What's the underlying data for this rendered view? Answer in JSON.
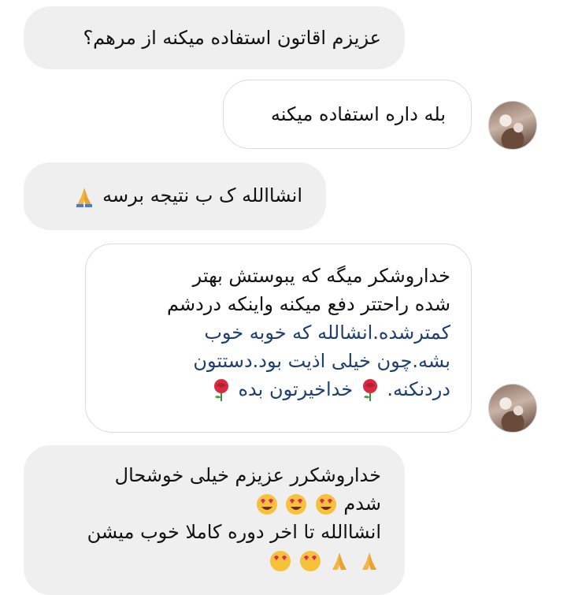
{
  "messages": [
    {
      "text": "عزیزم اقاتون استفاده میکنه از مرهم؟"
    },
    {
      "text": "بله داره استفاده میکنه"
    },
    {
      "text": "انشاالله ک ب نتیجه برسه"
    },
    {
      "lines": [
        "خداروشکر میگه که یبوستش بهتر",
        "شده راحتتر دفع میکنه واینکه دردشم",
        "کمترشده.انشالله که خوبه خوب",
        "بشه.چون خیلی اذیت بود.دستتون",
        "دردنکنه.",
        "خداخیرتون بده"
      ]
    },
    {
      "lines": [
        "خداروشکرر عزیزم خیلی خوشحال",
        "شدم",
        "انشاالله تا اخر دوره کاملا خوب میشن"
      ]
    }
  ],
  "icons": {
    "pray": "folded-hands-icon",
    "rose": "rose-icon",
    "heart_eyes": "heart-eyes-icon",
    "avatar": "avatar-photo"
  }
}
